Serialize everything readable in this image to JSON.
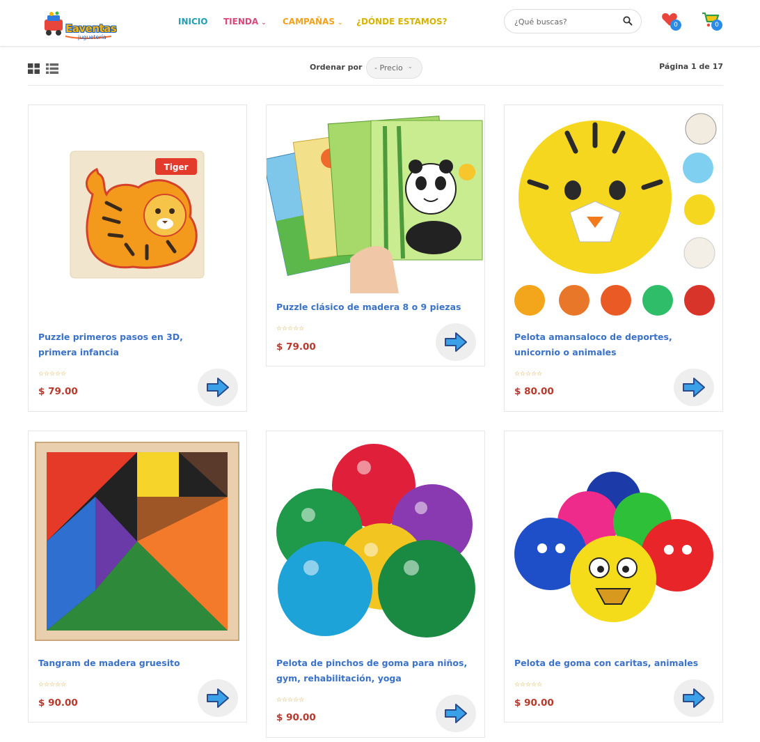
{
  "header": {
    "logo_text": "Eaventas",
    "logo_sub": "juguetería",
    "nav": [
      {
        "label": "INICIO",
        "color": "#1e9fb4",
        "has_chevron": false
      },
      {
        "label": "TIENDA",
        "color": "#d9487a",
        "has_chevron": true
      },
      {
        "label": "CAMPAÑAS",
        "color": "#f2a21b",
        "has_chevron": true
      },
      {
        "label": "¿DÓNDE ESTAMOS?",
        "color": "#d6b300",
        "has_chevron": false
      }
    ],
    "search_placeholder": "¿Qué buscas?",
    "wishlist_count": "0",
    "cart_count": "0"
  },
  "toolbar": {
    "sort_label": "Ordenar por",
    "sort_value": "- Precio",
    "page_info": "Página 1 de 17"
  },
  "products": [
    {
      "title": "Puzzle primeros pasos en 3D, primera infancia",
      "price": "$ 79.00",
      "rating": 0
    },
    {
      "title": "Puzzle clásico de madera 8 o 9 piezas",
      "price": "$ 79.00",
      "rating": 0
    },
    {
      "title": "Pelota amansaloco de deportes, unicornio o animales",
      "price": "$ 80.00",
      "rating": 0
    },
    {
      "title": "Tangram de madera gruesito",
      "price": "$ 90.00",
      "rating": 0
    },
    {
      "title": "Pelota de pinchos de goma para niños, gym, rehabilitación, yoga",
      "price": "$ 90.00",
      "rating": 0
    },
    {
      "title": "Pelota de goma con caritas, animales",
      "price": "$ 90.00",
      "rating": 0
    }
  ],
  "colors": {
    "title_blue": "#3a72c9",
    "price_red": "#b8392c",
    "badge_blue": "#2c8be6",
    "arrow_blue": "#3aa0e8"
  },
  "icons": [
    "search-icon",
    "heart-icon",
    "cart-icon",
    "grid-view-icon",
    "list-view-icon",
    "chevron-down-icon",
    "arrow-right-icon",
    "star-icon"
  ]
}
